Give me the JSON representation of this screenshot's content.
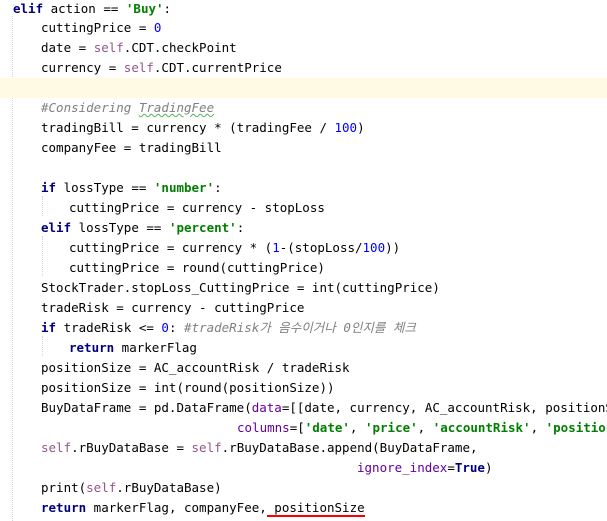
{
  "editor": {
    "lines": [
      {
        "tokens": [
          {
            "t": "elif",
            "c": "kw"
          },
          {
            "t": " action == "
          },
          {
            "t": "'Buy'",
            "c": "str"
          },
          {
            "t": ":"
          }
        ]
      },
      {
        "tokens": [
          {
            "t": "cuttingPrice = "
          },
          {
            "t": "0",
            "c": "num"
          }
        ]
      },
      {
        "tokens": [
          {
            "t": "date = "
          },
          {
            "t": "self",
            "c": "selfkw"
          },
          {
            "t": ".CDT.checkPoint"
          }
        ]
      },
      {
        "tokens": [
          {
            "t": "currency = "
          },
          {
            "t": "self",
            "c": "selfkw"
          },
          {
            "t": ".CDT.currentPrice"
          }
        ]
      },
      {
        "tokens": []
      },
      {
        "tokens": [
          {
            "t": "#Considering ",
            "c": "cmt"
          },
          {
            "t": "TradingFee",
            "c": "cmt spell"
          }
        ]
      },
      {
        "tokens": [
          {
            "t": "tradingBill = currency * (tradingFee / "
          },
          {
            "t": "100",
            "c": "num"
          },
          {
            "t": ")"
          }
        ]
      },
      {
        "tokens": [
          {
            "t": "companyFee = tradingBill"
          }
        ]
      },
      {
        "tokens": []
      },
      {
        "tokens": [
          {
            "t": "if",
            "c": "kw"
          },
          {
            "t": " lossType == "
          },
          {
            "t": "'number'",
            "c": "str"
          },
          {
            "t": ":"
          }
        ]
      },
      {
        "tokens": [
          {
            "t": "cuttingPrice = currency - stopLoss"
          }
        ]
      },
      {
        "tokens": [
          {
            "t": "elif",
            "c": "kw"
          },
          {
            "t": " lossType == "
          },
          {
            "t": "'percent'",
            "c": "str"
          },
          {
            "t": ":"
          }
        ]
      },
      {
        "tokens": [
          {
            "t": "cuttingPrice = currency * ("
          },
          {
            "t": "1",
            "c": "num"
          },
          {
            "t": "-(stopLoss/"
          },
          {
            "t": "100",
            "c": "num"
          },
          {
            "t": "))"
          }
        ]
      },
      {
        "tokens": [
          {
            "t": "cuttingPrice = round(cuttingPrice)"
          }
        ]
      },
      {
        "tokens": [
          {
            "t": "StockTrader.stopLoss_CuttingPrice = int(cuttingPrice)"
          }
        ]
      },
      {
        "tokens": [
          {
            "t": "tradeRisk = currency - cuttingPrice"
          }
        ]
      },
      {
        "tokens": [
          {
            "t": "if",
            "c": "kw"
          },
          {
            "t": " tradeRisk <= "
          },
          {
            "t": "0",
            "c": "num"
          },
          {
            "t": ": "
          },
          {
            "t": "#tradeRisk가 음수이거나 0인지를 체크",
            "c": "cmt"
          }
        ]
      },
      {
        "tokens": [
          {
            "t": "return",
            "c": "kw"
          },
          {
            "t": " markerFlag"
          }
        ]
      },
      {
        "tokens": [
          {
            "t": "positionSize = AC_accountRisk / tradeRisk"
          }
        ]
      },
      {
        "tokens": [
          {
            "t": "positionSize = int(round(positionSize))"
          }
        ]
      },
      {
        "tokens": [
          {
            "t": "BuyDataFrame = pd.DataFrame("
          },
          {
            "t": "data",
            "c": "param"
          },
          {
            "t": "=[[date, currency, AC_accountRisk, positionSize,"
          }
        ]
      },
      {
        "tokens": [
          {
            "t": "columns",
            "c": "param"
          },
          {
            "t": "=["
          },
          {
            "t": "'date'",
            "c": "str"
          },
          {
            "t": ", "
          },
          {
            "t": "'price'",
            "c": "str"
          },
          {
            "t": ", "
          },
          {
            "t": "'accountRisk'",
            "c": "str"
          },
          {
            "t": ", "
          },
          {
            "t": "'positionSiz",
            "c": "str"
          }
        ]
      },
      {
        "tokens": [
          {
            "t": "self",
            "c": "selfkw"
          },
          {
            "t": ".rBuyDataBase = "
          },
          {
            "t": "self",
            "c": "selfkw"
          },
          {
            "t": ".rBuyDataBase.append(BuyDataFrame,"
          }
        ]
      },
      {
        "tokens": [
          {
            "t": "ignore_index",
            "c": "param"
          },
          {
            "t": "="
          },
          {
            "t": "True",
            "c": "kw"
          },
          {
            "t": ")"
          }
        ]
      },
      {
        "tokens": [
          {
            "t": "print("
          },
          {
            "t": "self",
            "c": "selfkw"
          },
          {
            "t": ".rBuyDataBase)"
          }
        ]
      },
      {
        "tokens": [
          {
            "t": "return",
            "c": "kw"
          },
          {
            "t": " markerFlag, companyFee,"
          },
          {
            "t": " positionSize",
            "c": "err"
          }
        ]
      }
    ]
  }
}
